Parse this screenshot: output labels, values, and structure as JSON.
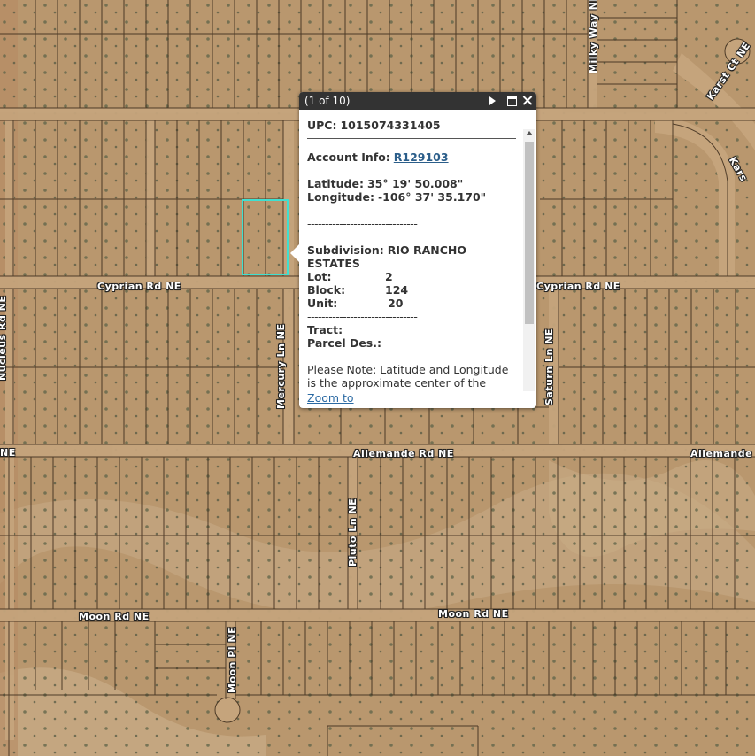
{
  "popup": {
    "count": "(1 of 10)",
    "upc_label": "UPC:",
    "upc_value": "1015074331405",
    "account_label": "Account Info:",
    "account_value": "R129103",
    "latitude_label": "Latitude:",
    "latitude_value": "35° 19' 50.008\"",
    "longitude_label": "Longitude:",
    "longitude_value": "-106° 37' 35.170\"",
    "dashes": "-------------------------------",
    "subdivision_label": "Subdivision:",
    "subdivision_value": "RIO RANCHO ESTATES",
    "lot_label": "Lot:",
    "lot_value": "2",
    "block_label": "Block:",
    "block_value": "124",
    "unit_label": "Unit:",
    "unit_value": "20",
    "tract_label": "Tract:",
    "parcel_label": "Parcel Des.:",
    "note": "Please Note: Latitude and Longitude is the approximate center of the parcel shown.",
    "zoom_to": "Zoom to"
  },
  "roads": {
    "milky_way": "Milky Way NE",
    "karst_ct": "Karst Ct NE",
    "karst": "Kars",
    "cyprian_left": "Cyprian Rd NE",
    "cyprian_right": "Cyprian Rd NE",
    "mercury": "Mercury Ln NE",
    "saturn": "Saturn Ln NE",
    "left_vertical": "Nucleus Rd NE",
    "allemande_left": "NE",
    "allemande_mid": "Allemande Rd NE",
    "allemande_right": "Allemande R",
    "pluto": "Pluto Ln NE",
    "moon_left": "Moon Rd NE",
    "moon_mid": "Moon Rd NE",
    "moon_pl": "Moon Pl NE"
  },
  "colors": {
    "terrain": "#b9976e",
    "parcel_line": "#3a2a1a",
    "selection": "#3fe0d0",
    "popup_header": "#333333"
  }
}
